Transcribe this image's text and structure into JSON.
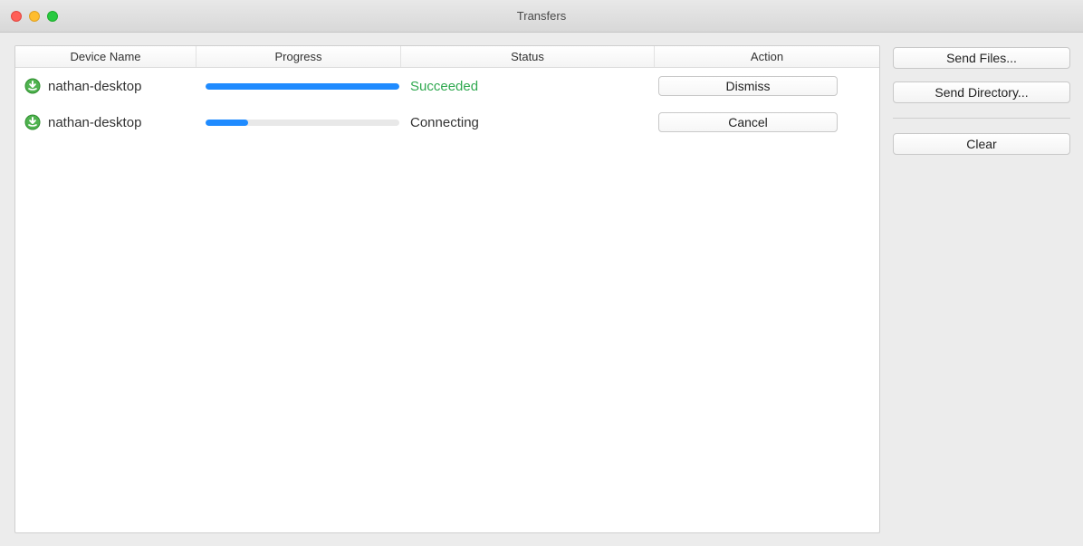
{
  "window": {
    "title": "Transfers"
  },
  "table": {
    "headers": {
      "device": "Device Name",
      "progress": "Progress",
      "status": "Status",
      "action": "Action"
    },
    "rows": [
      {
        "device": "nathan-desktop",
        "progressPct": 100,
        "status": "Succeeded",
        "statusKind": "succeeded",
        "actionLabel": "Dismiss"
      },
      {
        "device": "nathan-desktop",
        "progressPct": 22,
        "status": "Connecting",
        "statusKind": "other",
        "actionLabel": "Cancel"
      }
    ]
  },
  "sidebar": {
    "sendFiles": "Send Files...",
    "sendDirectory": "Send Directory...",
    "clear": "Clear"
  }
}
